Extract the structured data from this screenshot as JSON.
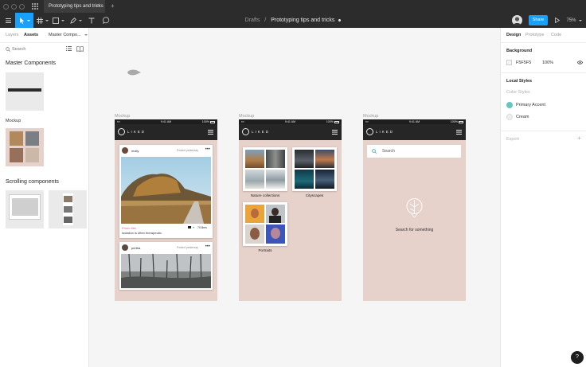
{
  "titlebar": {
    "tab_label": "Prototyping tips and tricks",
    "new_tab_symbol": "+"
  },
  "toolbar": {
    "breadcrumb_project": "Drafts",
    "breadcrumb_separator": "/",
    "breadcrumb_file": "Prototyping tips and tricks",
    "share_label": "Share",
    "zoom_label": "75%"
  },
  "left_panel": {
    "tabs": [
      "Layers",
      "Assets",
      "Master Compo..."
    ],
    "search_placeholder": "Search",
    "master_components_title": "Master Components",
    "mockup_label": "Mockup",
    "scrolling_components_title": "Scrolling components"
  },
  "frames": [
    {
      "label": "Mockup",
      "status_time": "9:41 AM",
      "status_battery": "100%",
      "brand": "LIKED"
    },
    {
      "label": "Mockup",
      "status_time": "9:41 AM",
      "status_battery": "100%",
      "brand": "LIKED"
    },
    {
      "label": "Mockup",
      "status_time": "9:41 AM",
      "status_battery": "100%",
      "brand": "LIKED"
    }
  ],
  "feed": {
    "post1_user": "molly",
    "post1_time": "Posted yesterday",
    "post1_title": "Photo title",
    "post1_caption": "Isolation is often therapeutic.",
    "post1_likes": "75 likes",
    "post2_user": "pertha",
    "post2_time": "Posted yesterday"
  },
  "collections": {
    "nature": "Nature collections",
    "cityscapes": "Cityscapes",
    "portraits": "Portraits"
  },
  "search_screen": {
    "placeholder": "Search",
    "empty_message": "Search for something"
  },
  "right_panel": {
    "tabs": [
      "Design",
      "Prototype",
      "Code"
    ],
    "background_title": "Background",
    "background_hex": "F5F5F5",
    "background_opacity": "100%",
    "local_styles_title": "Local Styles",
    "color_styles_label": "Color Styles",
    "styles": [
      {
        "name": "Primary Accent",
        "color": "#63c7c0"
      },
      {
        "name": "Cream",
        "color": "#eeeeee"
      }
    ],
    "export_label": "Export",
    "export_add": "+"
  },
  "colors": {
    "accent": "#18a0fb",
    "phone_bg": "#e6d1cb",
    "primary_accent": "#63c7c0",
    "toolbar": "#2c2c2c"
  },
  "help_label": "?"
}
